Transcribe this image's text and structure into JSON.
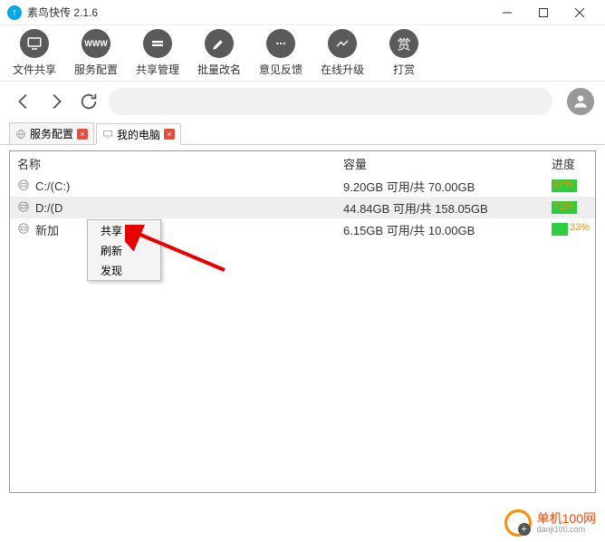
{
  "titlebar": {
    "title": "素鸟快传 2.1.6"
  },
  "toolbar": [
    {
      "label": "文件共享",
      "icon": "monitor"
    },
    {
      "label": "服务配置",
      "icon": "www"
    },
    {
      "label": "共享管理",
      "icon": "folder"
    },
    {
      "label": "批量改名",
      "icon": "pencil"
    },
    {
      "label": "意见反馈",
      "icon": "chat"
    },
    {
      "label": "在线升级",
      "icon": "trend"
    },
    {
      "label": "打赏",
      "icon": "reward"
    }
  ],
  "tabs": [
    {
      "label": "服务配置",
      "active": false
    },
    {
      "label": "我的电脑",
      "active": true
    }
  ],
  "table": {
    "headers": {
      "name": "名称",
      "capacity": "容量",
      "progress": "进度"
    },
    "rows": [
      {
        "name": "C:/(C:)",
        "capacity": "9.20GB 可用/共 70.00GB",
        "pct": "87%"
      },
      {
        "name": "D:/(D",
        "capacity": "44.84GB 可用/共 158.05GB",
        "pct": "72%"
      },
      {
        "name": "新加",
        "capacity": "6.15GB 可用/共 10.00GB",
        "pct": "33%"
      }
    ]
  },
  "contextMenu": {
    "items": [
      "共享",
      "刷新",
      "发现"
    ]
  },
  "watermark": {
    "main": "单机100网",
    "sub": "danji100.com"
  }
}
